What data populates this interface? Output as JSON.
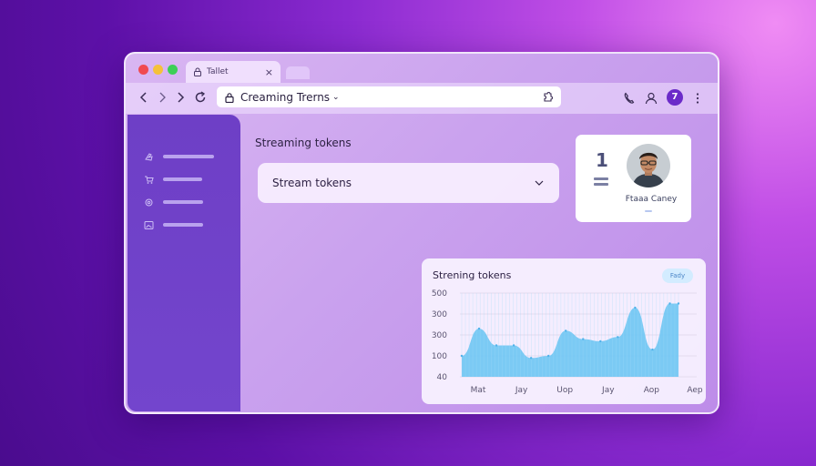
{
  "browser": {
    "tab_title": "Tallet",
    "tab_close": "×",
    "url_text": "Creaming Trerns",
    "url_chevron": "⌄"
  },
  "toolbar": {
    "back_icon": "chevron-left-icon",
    "forward_icon": "chevron-right-icon",
    "reload_icon": "reload-icon",
    "profile_letter": "7"
  },
  "sidebar": {
    "items": [
      {
        "icon": "hand-icon"
      },
      {
        "icon": "cart-icon"
      },
      {
        "icon": "gear-icon"
      },
      {
        "icon": "image-icon"
      }
    ]
  },
  "main": {
    "section_title": "Streaming tokens",
    "dropdown_value": "Stream tokens"
  },
  "profile_card": {
    "number": "1",
    "name": "Ftaaa Caney"
  },
  "chart_data": {
    "type": "area",
    "title": "Strening tokens",
    "badge": "Fady",
    "y_ticks": [
      "500",
      "300",
      "300",
      "100",
      "40"
    ],
    "x_ticks": [
      "Mat",
      "Jay",
      "Uop",
      "Jay",
      "Aop",
      "Aep"
    ],
    "y_tick_values": [
      500,
      400,
      300,
      200,
      100
    ],
    "ylim": [
      100,
      500
    ],
    "x": [
      0,
      0.4,
      0.8,
      1.2,
      1.6,
      2.0,
      2.4,
      2.8,
      3.2,
      3.6,
      4.0,
      4.4,
      4.8,
      5.0
    ],
    "values": [
      200,
      330,
      250,
      250,
      190,
      200,
      320,
      280,
      270,
      290,
      430,
      230,
      450,
      450
    ],
    "color": "#6ec5f3"
  }
}
